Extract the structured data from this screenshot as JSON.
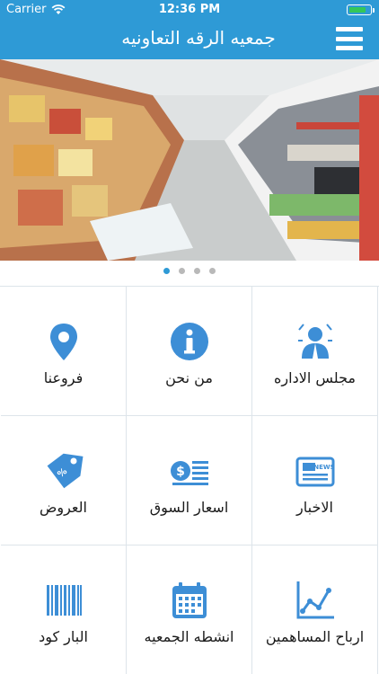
{
  "status_bar": {
    "carrier": "Carrier",
    "time": "12:36 PM",
    "battery_level": 0.8
  },
  "header": {
    "title": "جمعيه الرقه التعاونيه",
    "menu_icon": "hamburger-menu-icon"
  },
  "banner": {
    "image": "supermarket-aisle-photo",
    "page_count": 4,
    "active_page": 1
  },
  "colors": {
    "primary": "#2e9ad6",
    "icon": "#3d8ed6",
    "grid_border": "#dde4ea"
  },
  "tiles": [
    {
      "label": "مجلس الاداره",
      "icon": "board-member-icon"
    },
    {
      "label": "من نحن",
      "icon": "info-icon"
    },
    {
      "label": "فروعنا",
      "icon": "location-pin-icon"
    },
    {
      "label": "الاخبار",
      "icon": "newspaper-icon"
    },
    {
      "label": "اسعار السوق",
      "icon": "price-list-icon"
    },
    {
      "label": "العروض",
      "icon": "price-tag-icon"
    },
    {
      "label": "ارباح المساهمين",
      "icon": "line-chart-icon"
    },
    {
      "label": "انشطه الجمعيه",
      "icon": "calendar-icon"
    },
    {
      "label": "البار كود",
      "icon": "barcode-icon"
    }
  ]
}
